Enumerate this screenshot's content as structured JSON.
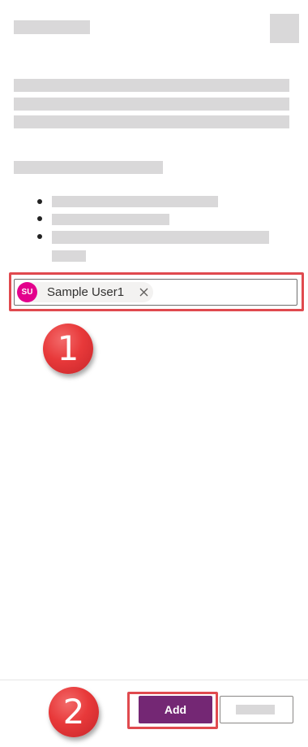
{
  "picker": {
    "selected_user": {
      "initials": "SU",
      "name": "Sample User1",
      "avatar_color": "#e3008c"
    }
  },
  "callouts": {
    "step1": "1",
    "step2": "2",
    "color": "#e8393a"
  },
  "footer": {
    "add_label": "Add",
    "add_color": "#742774"
  },
  "icons": {
    "close_chip": "close-icon",
    "panel_close": "close-icon"
  }
}
